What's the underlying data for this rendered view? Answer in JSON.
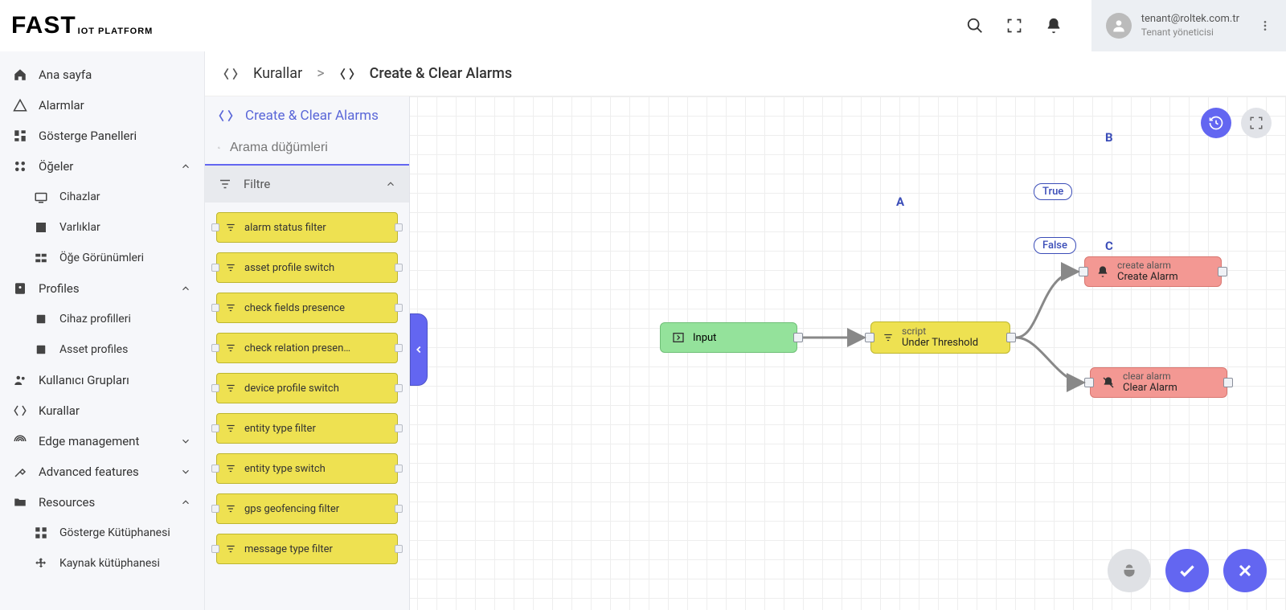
{
  "brand": {
    "main": "FAST",
    "sub": "IOT PLATFORM"
  },
  "user": {
    "email": "tenant@roltek.com.tr",
    "role": "Tenant yöneticisi"
  },
  "sidebar": {
    "home": "Ana sayfa",
    "alarms": "Alarmlar",
    "dashboards": "Gösterge Panelleri",
    "items": "Öğeler",
    "devices": "Cihazlar",
    "entities": "Varlıklar",
    "item_views": "Öğe Görünümleri",
    "profiles": "Profiles",
    "device_profiles": "Cihaz profilleri",
    "asset_profiles": "Asset profiles",
    "user_groups": "Kullanıcı Grupları",
    "rules": "Kurallar",
    "edge": "Edge management",
    "advanced": "Advanced features",
    "resources": "Resources",
    "dashboard_lib": "Gösterge Kütüphanesi",
    "source_lib": "Kaynak kütüphanesi"
  },
  "breadcrumb": {
    "rules": "Kurallar",
    "current": "Create & Clear Alarms"
  },
  "panel": {
    "title": "Create & Clear Alarms",
    "search_placeholder": "Arama düğümleri",
    "filter_header": "Filtre",
    "nodes": [
      "alarm status filter",
      "asset profile switch",
      "check fields presence",
      "check relation presen…",
      "device profile switch",
      "entity type filter",
      "entity type switch",
      "gps geofencing filter",
      "message type filter"
    ]
  },
  "flow": {
    "input_label": "Input",
    "script": {
      "type": "script",
      "name": "Under Threshold"
    },
    "create": {
      "type": "create alarm",
      "name": "Create Alarm"
    },
    "clear": {
      "type": "clear alarm",
      "name": "Clear Alarm"
    },
    "markers": {
      "a": "A",
      "b": "B",
      "c": "C"
    },
    "labels": {
      "true": "True",
      "false": "False"
    }
  }
}
